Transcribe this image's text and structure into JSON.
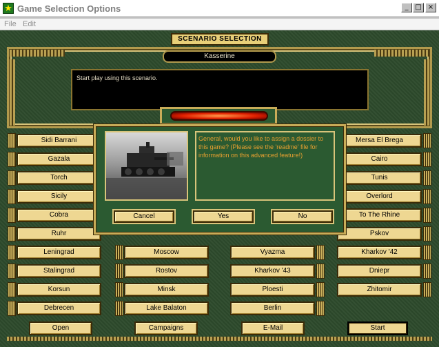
{
  "window": {
    "title": "Game Selection Options",
    "min": "_",
    "max": "□",
    "close": "×"
  },
  "menu": {
    "file": "File",
    "edit": "Edit"
  },
  "header": {
    "banner": "SCENARIO SELECTION",
    "current": "Kasserine",
    "description": "Start play using this scenario."
  },
  "scenarios": {
    "left_col": [
      "Sidi Barrani",
      "Gazala",
      "Torch",
      "Sicily",
      "Cobra",
      "Ruhr",
      "Leningrad",
      "Stalingrad",
      "Korsun",
      "Debrecen"
    ],
    "right_col": [
      "Mersa El Brega",
      "Cairo",
      "Tunis",
      "Overlord",
      "To The Rhine",
      "Pskov",
      "Kharkov '42",
      "Dniepr",
      "Zhitomir"
    ],
    "col2": [
      "Moscow",
      "Rostov",
      "Minsk",
      "Lake Balaton"
    ],
    "col3": [
      "Vyazma",
      "Kharkov '43",
      "Ploesti",
      "Berlin"
    ]
  },
  "dialog": {
    "message": "General, would you like to assign a dossier to this game? (Please see the 'readme' file for information on this advanced feature!)",
    "cancel": "Cancel",
    "yes": "Yes",
    "no": "No"
  },
  "bottom": {
    "open": "Open",
    "campaigns": "Campaigns",
    "email": "E-Mail",
    "start": "Start"
  },
  "colors": {
    "felt": "#2d4a2c",
    "gold": "#eed792",
    "frame": "#b29a4d",
    "msg_text": "#e8a030"
  }
}
